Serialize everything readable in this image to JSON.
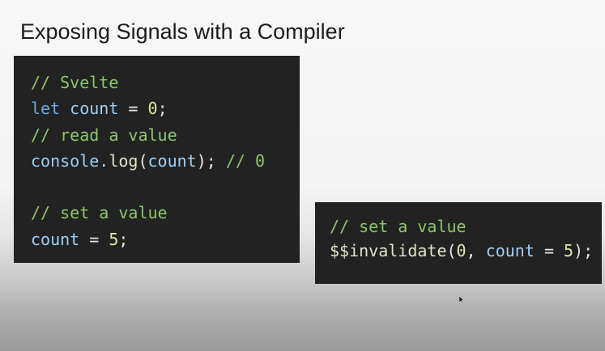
{
  "slide": {
    "title": "Exposing Signals with a Compiler"
  },
  "left_code": {
    "l1": {
      "comment": "// Svelte"
    },
    "l2": {
      "kw": "let",
      "var": "count",
      "rest": " = ",
      "num": "0",
      "end": ";"
    },
    "l3": {
      "comment": "// read a value"
    },
    "l4": {
      "obj": "console.",
      "fn": "log",
      "open": "(",
      "arg": "count",
      "close": ");",
      "comment": " // 0"
    },
    "l6": {
      "comment": "// set a value"
    },
    "l7": {
      "var": "count",
      "rest": " = ",
      "num": "5",
      "end": ";"
    }
  },
  "right_code": {
    "l1": {
      "comment": "// set a value"
    },
    "l2": {
      "fn": "$$invalidate",
      "open": "(",
      "num1": "0",
      "sep": ", ",
      "var": "count",
      "rest": " = ",
      "num2": "5",
      "end": ");"
    }
  },
  "colors": {
    "panel_bg": "#222222",
    "comment": "#8fc56a",
    "keyword": "#6aaae0",
    "variable": "#9ed0f5"
  }
}
